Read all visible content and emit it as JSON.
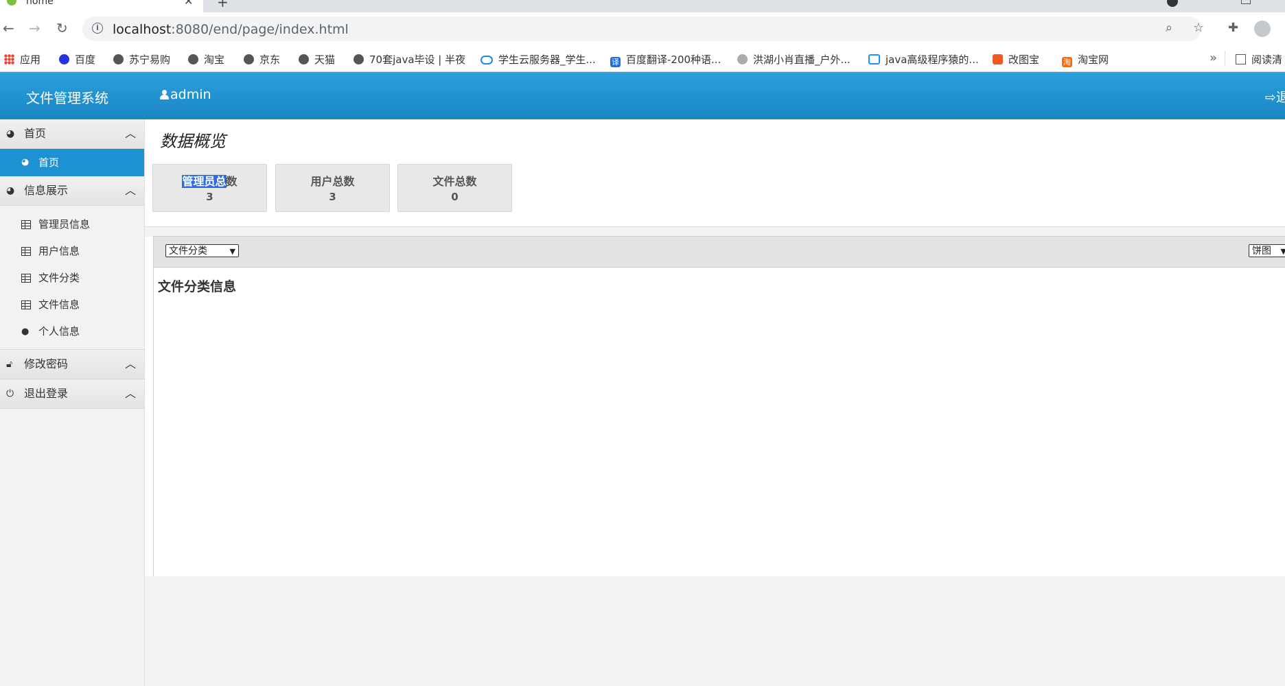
{
  "browser": {
    "tab_title": "home",
    "url_host": "localhost",
    "url_rest": ":8080/end/page/index.html",
    "bookmarks": [
      {
        "label": "应用",
        "icon": "apps-grid-icon"
      },
      {
        "label": "百度",
        "icon": "baidu-paw-icon"
      },
      {
        "label": "苏宁易购",
        "icon": "globe-icon"
      },
      {
        "label": "淘宝",
        "icon": "globe-icon"
      },
      {
        "label": "京东",
        "icon": "globe-icon"
      },
      {
        "label": "天猫",
        "icon": "globe-icon"
      },
      {
        "label": "70套java毕设 | 半夜",
        "icon": "globe-icon"
      },
      {
        "label": "学生云服务器_学生...",
        "icon": "cloud-icon"
      },
      {
        "label": "百度翻译-200种语...",
        "icon": "translate-icon"
      },
      {
        "label": "洪湖小肖直播_户外...",
        "icon": "feather-icon"
      },
      {
        "label": "java高级程序猿的...",
        "icon": "bilibili-tv-icon"
      },
      {
        "label": "改图宝",
        "icon": "orange-square-icon"
      },
      {
        "label": "淘宝网",
        "icon": "taobao-icon"
      }
    ],
    "bookmarks_more": "»",
    "reading_list": "阅读清"
  },
  "header": {
    "title": "文件管理系统",
    "user": "admin",
    "logout": "退"
  },
  "sidebar": {
    "groups": [
      {
        "label": "首页",
        "items": [
          {
            "label": "首页",
            "active": true
          }
        ]
      },
      {
        "label": "信息展示",
        "items": [
          {
            "label": "管理员信息"
          },
          {
            "label": "用户信息"
          },
          {
            "label": "文件分类"
          },
          {
            "label": "文件信息"
          },
          {
            "label": "个人信息"
          }
        ]
      },
      {
        "label": "修改密码",
        "items": []
      },
      {
        "label": "退出登录",
        "items": []
      }
    ]
  },
  "main": {
    "heading": "数据概览",
    "stats": [
      {
        "label_selected": "管理员总",
        "label_rest": "数",
        "value": "3"
      },
      {
        "label": "用户总数",
        "value": "3"
      },
      {
        "label": "文件总数",
        "value": "0"
      }
    ],
    "chart_select": "文件分类",
    "chart_type_select": "饼图",
    "chart_title": "文件分类信息"
  },
  "colors": {
    "header_blue": "#1a86c4",
    "active_item": "#1e91d2",
    "selection": "#2b6de8"
  }
}
